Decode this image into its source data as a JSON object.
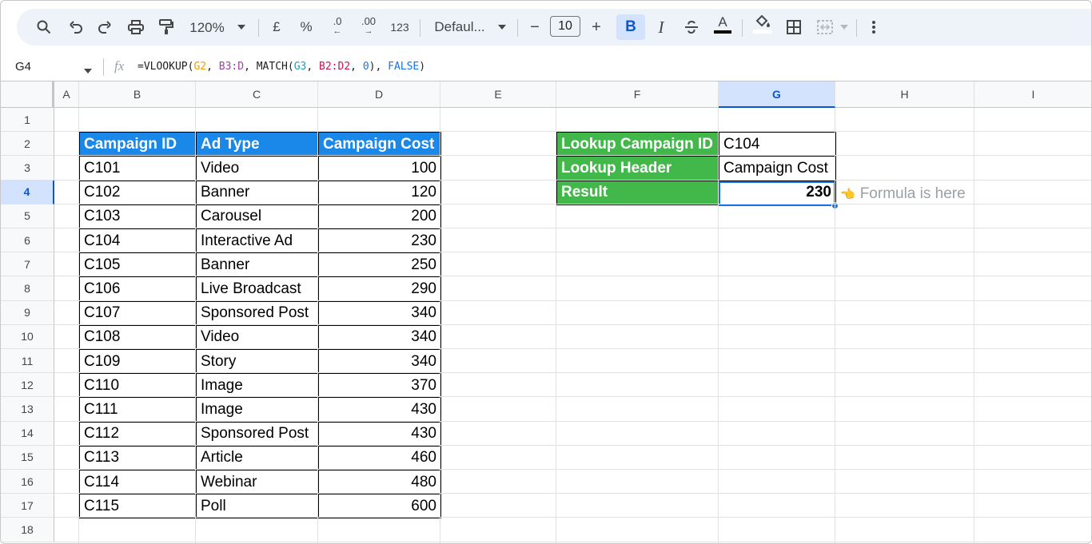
{
  "toolbar": {
    "zoom": "120%",
    "currency": "£",
    "percent": "%",
    "dec_decrease": ".0",
    "dec_increase": ".00",
    "number_format": "123",
    "font": "Defaul...",
    "font_size": "10",
    "bold": "B",
    "italic": "I",
    "text_color_letter": "A",
    "minus": "−",
    "plus": "+"
  },
  "formula_bar": {
    "name_box": "G4",
    "fx": "fx",
    "formula_parts": [
      {
        "t": "=VLOOKUP(",
        "c": "#1f1f1f"
      },
      {
        "t": "G2",
        "c": "#e8a000"
      },
      {
        "t": ", ",
        "c": "#1f1f1f"
      },
      {
        "t": "B3:D",
        "c": "#a23fa3"
      },
      {
        "t": ", MATCH(",
        "c": "#1f1f1f"
      },
      {
        "t": "G3",
        "c": "#18a3b7"
      },
      {
        "t": ", ",
        "c": "#1f1f1f"
      },
      {
        "t": "B2:D2",
        "c": "#c2185b"
      },
      {
        "t": ", ",
        "c": "#1f1f1f"
      },
      {
        "t": "0",
        "c": "#1a73e8"
      },
      {
        "t": "), ",
        "c": "#1f1f1f"
      },
      {
        "t": "FALSE",
        "c": "#1a73e8"
      },
      {
        "t": ")",
        "c": "#1f1f1f"
      }
    ]
  },
  "columns": [
    "A",
    "B",
    "C",
    "D",
    "E",
    "F",
    "G",
    "H",
    "I"
  ],
  "rows": [
    "1",
    "2",
    "3",
    "4",
    "5",
    "6",
    "7",
    "8",
    "9",
    "10",
    "11",
    "12",
    "13",
    "14",
    "15",
    "16",
    "17",
    "18"
  ],
  "selected_column": "G",
  "selected_row": "4",
  "table": {
    "headers": [
      "Campaign ID",
      "Ad Type",
      "Campaign Cost"
    ],
    "rows": [
      [
        "C101",
        "Video",
        "100"
      ],
      [
        "C102",
        "Banner",
        "120"
      ],
      [
        "C103",
        "Carousel",
        "200"
      ],
      [
        "C104",
        "Interactive Ad",
        "230"
      ],
      [
        "C105",
        "Banner",
        "250"
      ],
      [
        "C106",
        "Live Broadcast",
        "290"
      ],
      [
        "C107",
        "Sponsored Post",
        "340"
      ],
      [
        "C108",
        "Video",
        "340"
      ],
      [
        "C109",
        "Story",
        "340"
      ],
      [
        "C110",
        "Image",
        "370"
      ],
      [
        "C111",
        "Image",
        "430"
      ],
      [
        "C112",
        "Sponsored Post",
        "430"
      ],
      [
        "C113",
        "Article",
        "460"
      ],
      [
        "C114",
        "Webinar",
        "480"
      ],
      [
        "C115",
        "Poll",
        "600"
      ]
    ]
  },
  "lookup": {
    "rows": [
      {
        "label": "Lookup Campaign ID",
        "value": "C104"
      },
      {
        "label": "Lookup Header",
        "value": "Campaign Cost"
      },
      {
        "label": "Result",
        "value": "230"
      }
    ]
  },
  "annotation": {
    "icon": "👈",
    "text": "Formula is here"
  },
  "colors": {
    "header_blue": "#1a88e8",
    "header_green": "#43b84a",
    "selection": "#1a73e8"
  }
}
